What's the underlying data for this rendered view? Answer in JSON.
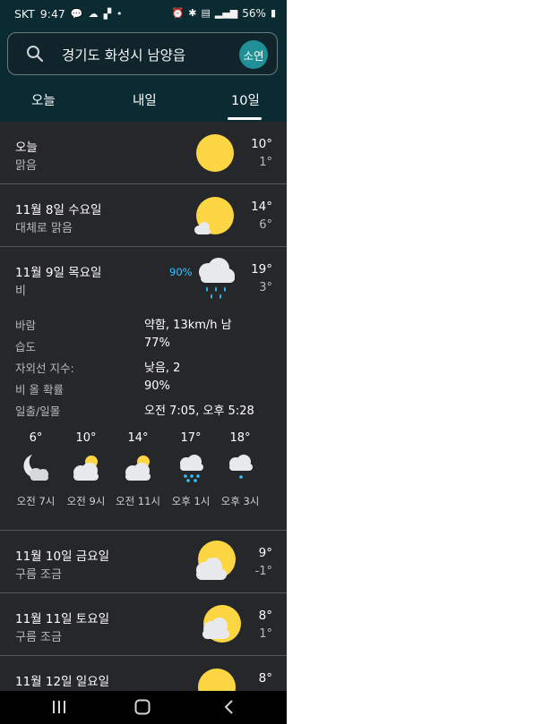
{
  "status_bar": {
    "carrier": "SKT",
    "time": "9:47",
    "battery": "56%",
    "icons": [
      "chat-icon",
      "cloud-icon",
      "flipboard-icon",
      "dot-icon",
      "alarm-icon",
      "bluetooth-icon",
      "volte-icon",
      "signal-icon",
      "battery-icon"
    ]
  },
  "search": {
    "location": "경기도 화성시 남양읍",
    "avatar_label": "소연"
  },
  "tabs": [
    {
      "label": "오늘",
      "selected": false
    },
    {
      "label": "내일",
      "selected": false
    },
    {
      "label": "10일",
      "selected": true
    }
  ],
  "days": [
    {
      "date": "오늘",
      "condition": "맑음",
      "high": "10°",
      "low": "1°",
      "icon": "sunny-icon"
    },
    {
      "date": "11월 8일 수요일",
      "condition": "대체로 맑음",
      "high": "14°",
      "low": "6°",
      "icon": "mostly-sunny-icon"
    }
  ],
  "expanded_day": {
    "date": "11월 9일 목요일",
    "condition": "비",
    "precip": "90%",
    "high": "19°",
    "low": "3°",
    "icon": "rain-icon",
    "details": [
      {
        "key": "바람",
        "value": "약함, 13km/h 남"
      },
      {
        "key": "습도",
        "value": "77%"
      },
      {
        "key": "자외선 지수:",
        "value": "낮음, 2"
      },
      {
        "key": "비 올 확률",
        "value": "90%"
      },
      {
        "key": "일출/일몰",
        "value": "오전 7:05, 오후 5:28"
      }
    ],
    "hourly": [
      {
        "temp": "6°",
        "time": "오전 7시",
        "icon": "moon-cloud-icon"
      },
      {
        "temp": "10°",
        "time": "오전 9시",
        "icon": "partly-cloudy-icon"
      },
      {
        "temp": "14°",
        "time": "오전 11시",
        "icon": "partly-cloudy-icon"
      },
      {
        "temp": "17°",
        "time": "오후 1시",
        "icon": "rain-icon"
      },
      {
        "temp": "18°",
        "time": "오후 3시",
        "icon": "light-rain-icon"
      }
    ]
  },
  "later_days": [
    {
      "date": "11월 10일 금요일",
      "condition": "구름 조금",
      "high": "9°",
      "low": "-1°",
      "icon": "partly-cloudy-icon"
    },
    {
      "date": "11월 11일 토요일",
      "condition": "구름 조금",
      "high": "8°",
      "low": "1°",
      "icon": "partly-cloudy-icon"
    },
    {
      "date": "11월 12일 일요일",
      "condition": "",
      "high": "8°",
      "low": "",
      "icon": "sunny-icon"
    }
  ],
  "colors": {
    "header_bg": "#0b2b33",
    "list_bg": "#26272b",
    "sun": "#fcd642",
    "precip": "#33c5ff",
    "avatar": "#1f8f98"
  }
}
